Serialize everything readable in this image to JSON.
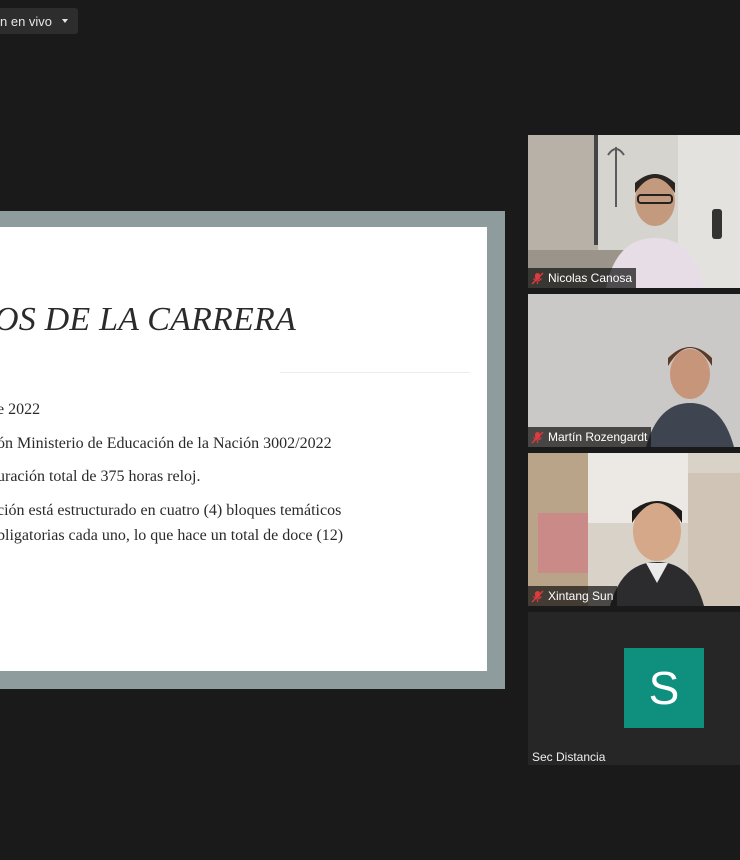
{
  "live_button": {
    "label": "n en vivo",
    "icon": "chevron-down-icon"
  },
  "slide": {
    "title": "OS DE LA CARRERA",
    "lines": [
      "e 2022",
      "ón Ministerio de Educación de la Nación 3002/2022",
      "uración total de 375 horas reloj.",
      "ción está estructurado en cuatro (4) bloques temáticos",
      "bligatorias cada uno, lo que hace un total de doce (12)"
    ]
  },
  "participants": [
    {
      "name": "Nicolas Canosa",
      "muted": true
    },
    {
      "name": "Martín Rozengardt",
      "muted": true
    },
    {
      "name": "Xintang Sun",
      "muted": true
    },
    {
      "name": "Sec Distancia",
      "avatar_letter": "S",
      "avatar_color": "#0f8f7d"
    }
  ],
  "colors": {
    "background": "#1a1a1a",
    "slide_frame": "#8e9c9d",
    "muted_icon": "#e0393e"
  }
}
